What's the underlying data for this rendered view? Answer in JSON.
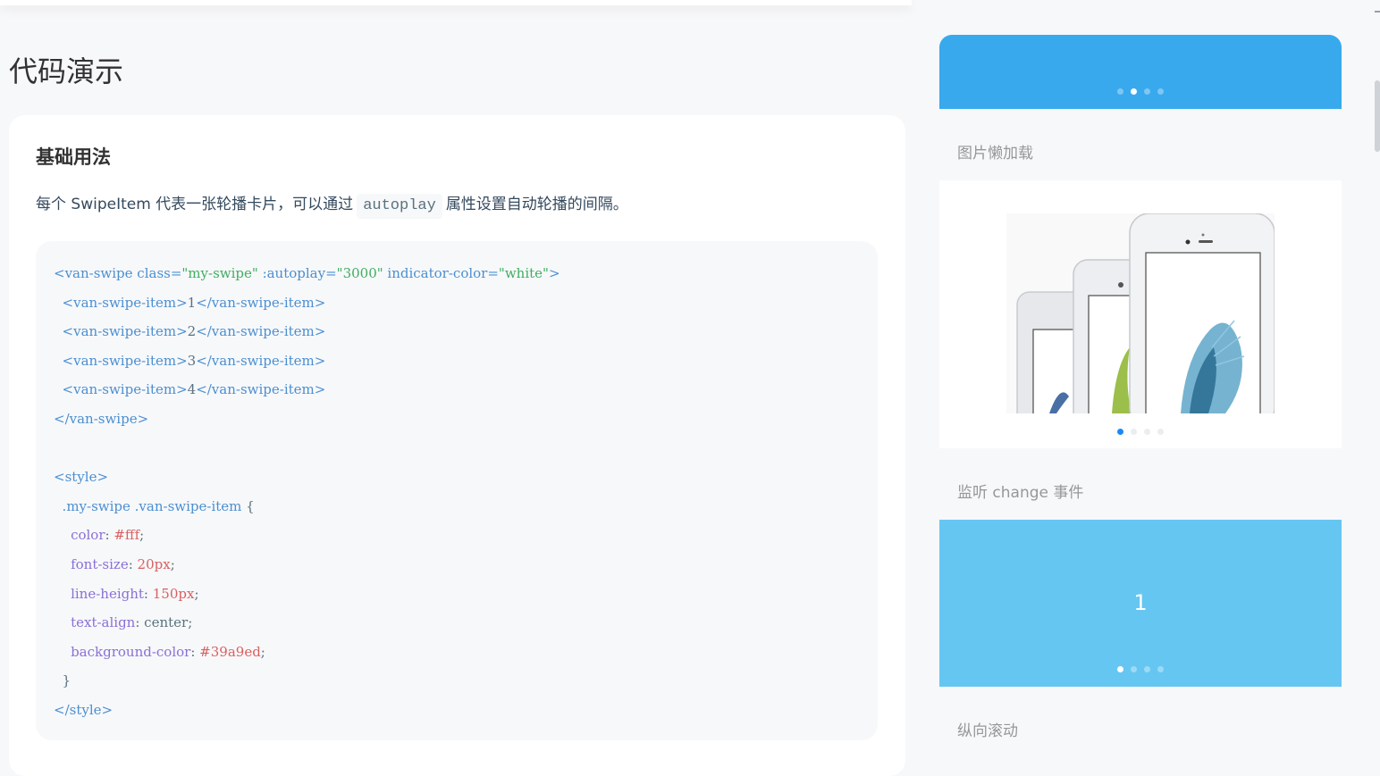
{
  "page": {
    "title": "代码演示"
  },
  "doc": {
    "section_title": "基础用法",
    "desc_before": "每个 SwipeItem 代表一张轮播卡片，可以通过",
    "desc_code": "autoplay",
    "desc_after": "属性设置自动轮播的间隔。"
  },
  "code": {
    "line1": {
      "t1": "<van-swipe",
      "a1": " class=",
      "s1": "\"my-swipe\"",
      "a2": " :autoplay=",
      "s2": "\"3000\"",
      "a3": " indicator-color=",
      "s3": "\"white\"",
      "t2": ">"
    },
    "items": [
      {
        "open": "<van-swipe-item>",
        "text": "1",
        "close": "</van-swipe-item>"
      },
      {
        "open": "<van-swipe-item>",
        "text": "2",
        "close": "</van-swipe-item>"
      },
      {
        "open": "<van-swipe-item>",
        "text": "3",
        "close": "</van-swipe-item>"
      },
      {
        "open": "<van-swipe-item>",
        "text": "4",
        "close": "</van-swipe-item>"
      }
    ],
    "close_swipe": "</van-swipe>",
    "style_open": "<style>",
    "selector": ".my-swipe .van-swipe-item",
    "brace_open": " {",
    "props": [
      {
        "name": "color",
        "value": "#fff",
        "value_type": "num"
      },
      {
        "name": "font-size",
        "value": "20px",
        "value_type": "num"
      },
      {
        "name": "line-height",
        "value": "150px",
        "value_type": "num"
      },
      {
        "name": "text-align",
        "value": "center",
        "value_type": "text"
      },
      {
        "name": "background-color",
        "value": "#39a9ed",
        "value_type": "num"
      }
    ],
    "brace_close": "}",
    "style_close": "</style>"
  },
  "preview": {
    "lazy_title": "图片懒加载",
    "change_title": "监听 change 事件",
    "change_number": "1",
    "vertical_title": "纵向滚动",
    "basic_swipe_active_index": 1,
    "lazy_swipe_active_index": 0,
    "change_swipe_active_index": 0,
    "dot_count": 4,
    "image": "phone-image"
  },
  "colors": {
    "basic_swipe_bg": "#39a9ed",
    "change_swipe_bg": "#66c6f2",
    "active_dot_blue": "#1989fa"
  }
}
